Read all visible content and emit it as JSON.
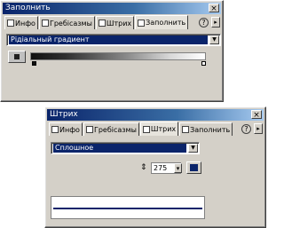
{
  "fill_panel": {
    "title": "Заполнить",
    "close_label": "×",
    "tabs": [
      {
        "label": "Инфо"
      },
      {
        "label": "Гребісазмы"
      },
      {
        "label": "Штрих"
      },
      {
        "label": "Заполнить"
      }
    ],
    "help_label": "?",
    "fill_type": "Рідіальный градиент",
    "gradient_colors": [
      "#101010",
      "#ffffff"
    ]
  },
  "stroke_panel": {
    "title": "Штрих",
    "close_label": "×",
    "tabs": [
      {
        "label": "Инфо"
      },
      {
        "label": "Гребісазмы"
      },
      {
        "label": "Штрих"
      },
      {
        "label": "Заполнить"
      }
    ],
    "help_label": "?",
    "stroke_type": "Сплошное",
    "stroke_width": "275",
    "stroke_color": "#0a246a"
  }
}
